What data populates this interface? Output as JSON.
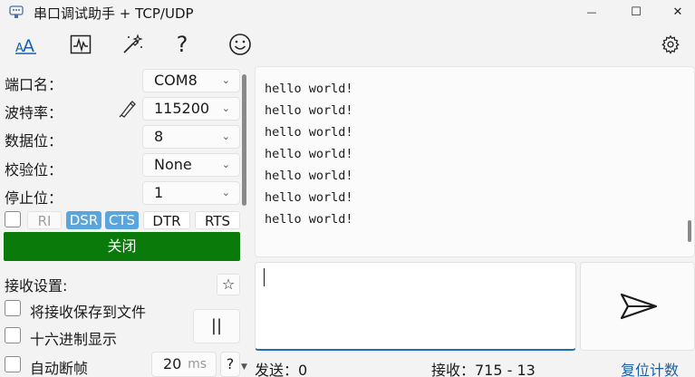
{
  "window": {
    "title": "串口调试助手 + TCP/UDP",
    "minimize_glyph": "—",
    "maximize_glyph": "☐",
    "close_glyph": "✕"
  },
  "toolbar": {
    "icons": [
      "font-icon",
      "waveform-icon",
      "theme-icon",
      "help-icon",
      "emoji-icon",
      "settings-icon"
    ],
    "help_glyph": "?",
    "emoji_glyph": "☺"
  },
  "serial": {
    "port_label": "端口名：",
    "port_value": "COM8",
    "baud_label": "波特率：",
    "baud_value": "115200",
    "databits_label": "数据位：",
    "databits_value": "8",
    "parity_label": "校验位：",
    "parity_value": "None",
    "stopbits_label": "停止位：",
    "stopbits_value": "1"
  },
  "signals": {
    "ri": "RI",
    "dsr": "DSR",
    "cts": "CTS",
    "dtr": "DTR",
    "rts": "RTS"
  },
  "actions": {
    "close_label": "关闭"
  },
  "receive_settings": {
    "title": "接收设置:",
    "star_glyph": "☆",
    "save_to_file": "将接收保存到文件",
    "hex_display": "十六进制显示",
    "auto_frame": "自动断帧",
    "pause_glyph": "||",
    "frame_ms_value": "20",
    "frame_ms_unit": "ms",
    "help_glyph": "?"
  },
  "receive_lines": [
    "hello world!",
    "hello world!",
    "hello world!",
    "hello world!",
    "hello world!",
    "hello world!",
    "hello world!"
  ],
  "send": {
    "input_value": ""
  },
  "status": {
    "sent": "发送：0",
    "received": "接收：715 - 13",
    "reset_label": "复位计数"
  },
  "colors": {
    "accent_green": "#0a7a0a",
    "signal_active": "#5aa5dc",
    "link_blue": "#1a5fa8",
    "input_focus": "#1a6fb5"
  }
}
